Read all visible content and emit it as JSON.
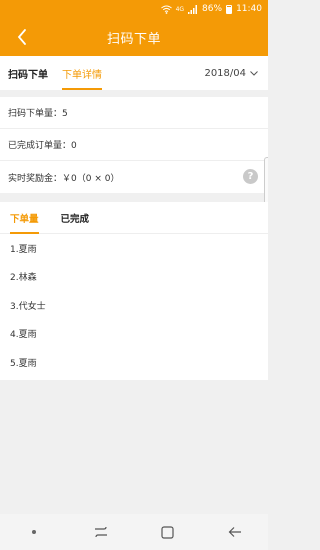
{
  "status": {
    "battery": "86%",
    "time": "11:40",
    "network": "4G"
  },
  "app_bar": {
    "title": "扫码下单"
  },
  "tabs": [
    {
      "label": "扫码下单"
    },
    {
      "label": "下单详情"
    }
  ],
  "date_select": {
    "value": "2018/04"
  },
  "stats": {
    "orders": "扫码下单量：5",
    "completed": "已完成订单量：0",
    "bonus": "实时奖励金：￥0（0 × 0）"
  },
  "sub_tabs": [
    {
      "label": "下单量"
    },
    {
      "label": "已完成"
    }
  ],
  "list": [
    "1.夏雨",
    "2.林森",
    "3.代女士",
    "4.夏雨",
    "5.夏雨"
  ],
  "colors": {
    "accent": "#f49a06"
  }
}
